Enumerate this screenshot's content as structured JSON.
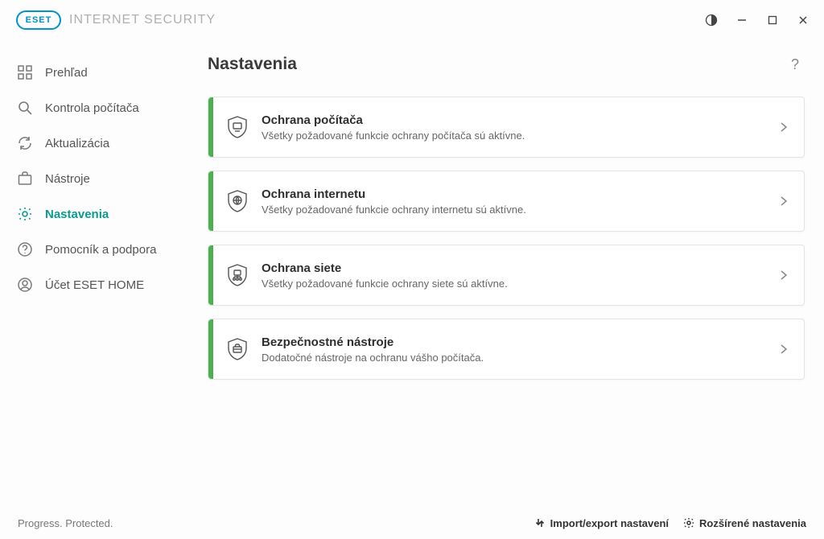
{
  "app": {
    "brand_mark": "ESET",
    "brand_name": "INTERNET SECURITY"
  },
  "sidebar": {
    "items": [
      {
        "label": "Prehľad",
        "icon": "dashboard-icon"
      },
      {
        "label": "Kontrola počítača",
        "icon": "search-icon"
      },
      {
        "label": "Aktualizácia",
        "icon": "refresh-icon"
      },
      {
        "label": "Nástroje",
        "icon": "toolbox-icon"
      },
      {
        "label": "Nastavenia",
        "icon": "gear-icon",
        "active": true
      },
      {
        "label": "Pomocník a podpora",
        "icon": "help-icon"
      },
      {
        "label": "Účet ESET HOME",
        "icon": "account-icon"
      }
    ]
  },
  "page": {
    "title": "Nastavenia"
  },
  "cards": [
    {
      "title": "Ochrana počítača",
      "desc": "Všetky požadované funkcie ochrany počítača sú aktívne.",
      "icon": "shield-monitor-icon"
    },
    {
      "title": "Ochrana internetu",
      "desc": "Všetky požadované funkcie ochrany internetu sú aktívne.",
      "icon": "shield-globe-icon"
    },
    {
      "title": "Ochrana siete",
      "desc": "Všetky požadované funkcie ochrany siete sú aktívne.",
      "icon": "shield-network-icon"
    },
    {
      "title": "Bezpečnostné nástroje",
      "desc": "Dodatočné nástroje na ochranu vášho počítača.",
      "icon": "shield-toolbox-icon"
    }
  ],
  "footer": {
    "tagline": "Progress. Protected.",
    "import_export": "Import/export nastavení",
    "advanced": "Rozšírené nastavenia"
  }
}
